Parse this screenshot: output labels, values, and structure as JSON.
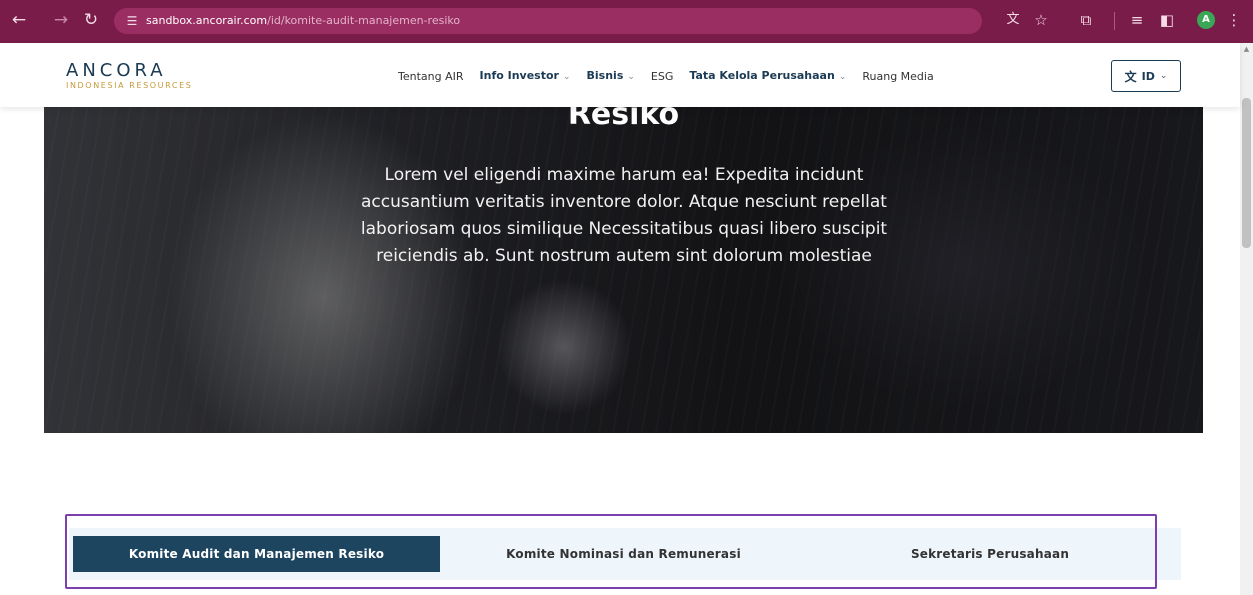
{
  "browser": {
    "url_host": "sandbox.ancorair.com",
    "url_path": "/id/komite-audit-manajemen-resiko",
    "profile_initial": "A",
    "icons": [
      "back-arrow-icon",
      "forward-arrow-icon",
      "reload-icon",
      "site-settings-icon",
      "translate-icon",
      "bookmark-star-icon",
      "extensions-icon",
      "reading-list-icon",
      "side-panel-icon",
      "menu-dots-icon"
    ]
  },
  "header": {
    "logo_main": "ANCORA",
    "logo_sub": "INDONESIA RESOURCES",
    "nav": [
      {
        "label": "Tentang AIR",
        "has_dropdown": false
      },
      {
        "label": "Info Investor",
        "has_dropdown": true
      },
      {
        "label": "Bisnis",
        "has_dropdown": true
      },
      {
        "label": "ESG",
        "has_dropdown": false
      },
      {
        "label": "Tata Kelola Perusahaan",
        "has_dropdown": true
      },
      {
        "label": "Ruang Media",
        "has_dropdown": false
      }
    ],
    "language": "ID"
  },
  "hero": {
    "title": "Resiko",
    "text": "Lorem vel eligendi maxime harum ea! Expedita incidunt accusantium veritatis inventore dolor. Atque nesciunt repellat laboriosam quos similique Necessitatibus quasi libero suscipit reiciendis ab. Sunt nostrum autem sint dolorum molestiae"
  },
  "tabs": [
    {
      "label": "Komite Audit dan Manajemen Resiko",
      "active": true
    },
    {
      "label": "Komite Nominasi dan Remunerasi",
      "active": false
    },
    {
      "label": "Sekretaris Perusahaan",
      "active": false
    }
  ],
  "colors": {
    "chrome": "#7a1c4a",
    "brand_navy": "#1b3a53",
    "brand_gold": "#c59a39",
    "active_tab": "#1d4560",
    "tab_bar": "#eef5fb",
    "highlight_frame": "#7b3fb0"
  }
}
